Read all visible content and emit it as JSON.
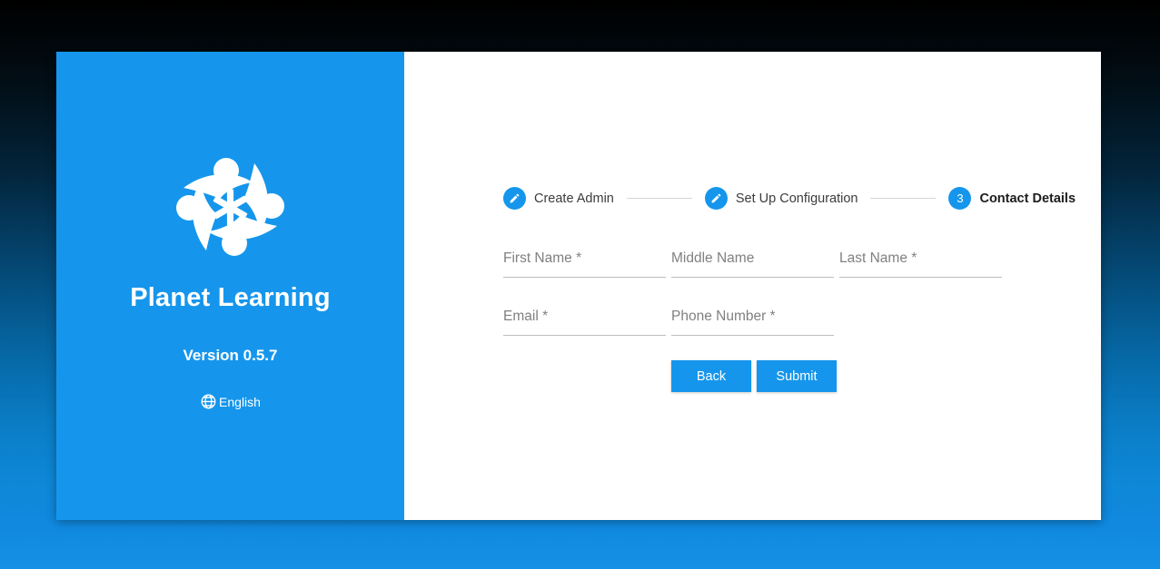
{
  "brand": {
    "logo_icon": "planet-learning-pinwheel-logo",
    "title": "Planet Learning",
    "version": "Version 0.5.7",
    "language_icon": "globe-icon",
    "language": "English",
    "panel_color": "#1596ec"
  },
  "stepper": {
    "steps": [
      {
        "badge_icon": "pencil-edit-icon",
        "badge_text": "",
        "label": "Create Admin",
        "state": "complete"
      },
      {
        "badge_icon": "pencil-edit-icon",
        "badge_text": "",
        "label": "Set Up Configuration",
        "state": "complete"
      },
      {
        "badge_icon": "step-number",
        "badge_text": "3",
        "label": "Contact Details",
        "state": "active"
      }
    ],
    "accent_color": "#1596ec",
    "connector_color": "#d6d6d6"
  },
  "form": {
    "fields": [
      {
        "name": "first-name",
        "placeholder": "First Name *",
        "value": ""
      },
      {
        "name": "middle-name",
        "placeholder": "Middle Name",
        "value": ""
      },
      {
        "name": "last-name",
        "placeholder": "Last Name *",
        "value": ""
      },
      {
        "name": "email",
        "placeholder": "Email *",
        "value": ""
      },
      {
        "name": "phone-number",
        "placeholder": "Phone Number *",
        "value": ""
      }
    ],
    "buttons": {
      "back": "Back",
      "submit": "Submit"
    }
  },
  "background": {
    "top_color": "#000000",
    "bottom_color": "#1490e4"
  }
}
